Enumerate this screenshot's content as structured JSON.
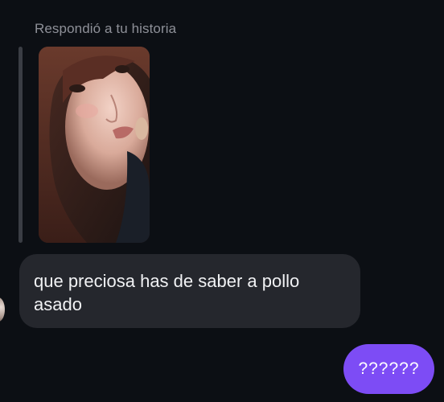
{
  "conversation": {
    "reply_context": {
      "label": "Respondió a tu historia",
      "story_thumbnail": "story-photo-portrait"
    },
    "messages": [
      {
        "direction": "incoming",
        "text": "que preciosa has de saber a pollo asado"
      },
      {
        "direction": "outgoing",
        "text": "??????"
      }
    ]
  },
  "colors": {
    "background": "#0c0f14",
    "incoming_bubble": "#25272d",
    "outgoing_bubble": "#7d4cf5",
    "secondary_text": "#8e9098"
  }
}
